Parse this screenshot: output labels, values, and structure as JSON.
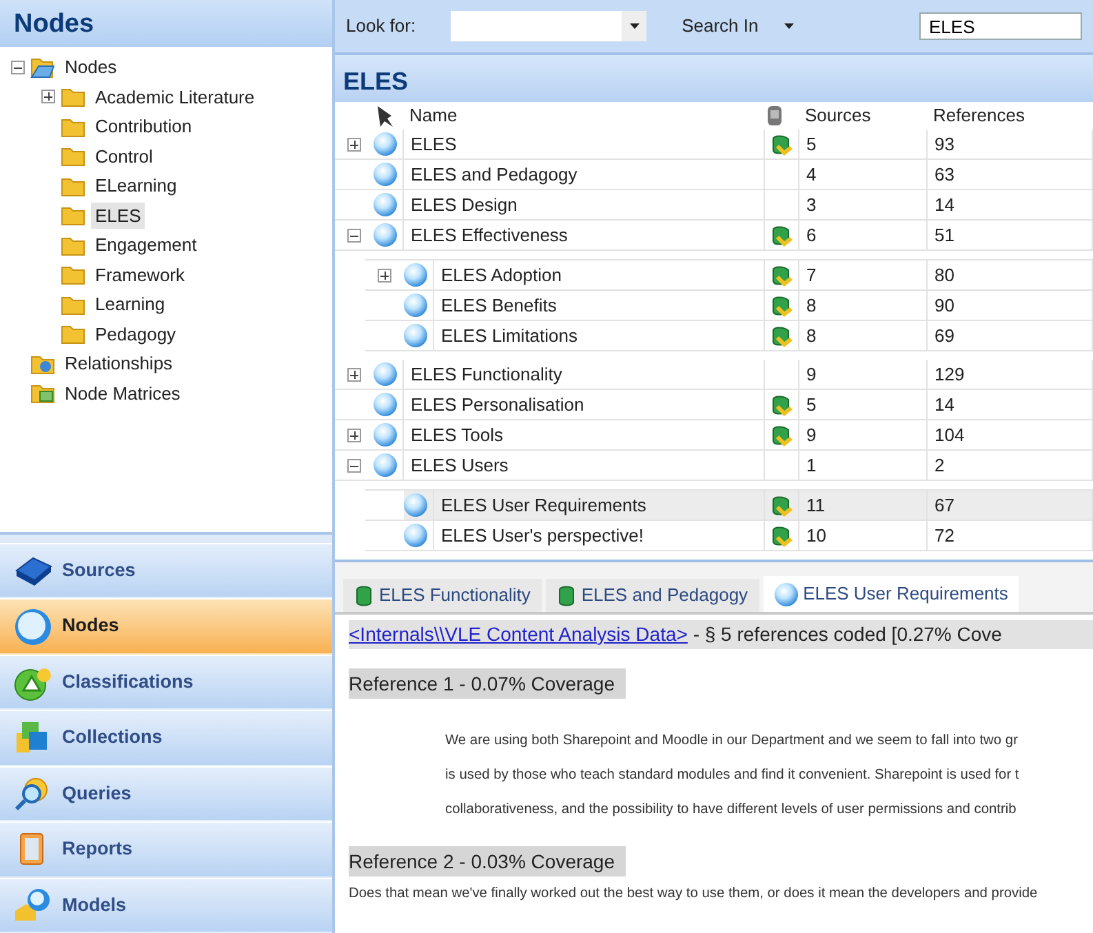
{
  "left_panel": {
    "title": "Nodes",
    "tree": [
      {
        "label": "Nodes",
        "kind": "open-folder",
        "expanded": true,
        "selected": false,
        "children": [
          {
            "label": "Academic Literature",
            "kind": "folder",
            "expanded": false,
            "selected": false
          },
          {
            "label": "Contribution",
            "kind": "folder",
            "selected": false
          },
          {
            "label": "Control",
            "kind": "folder",
            "selected": false
          },
          {
            "label": "ELearning",
            "kind": "folder",
            "selected": false
          },
          {
            "label": "ELES",
            "kind": "folder",
            "selected": true
          },
          {
            "label": "Engagement",
            "kind": "folder",
            "selected": false
          },
          {
            "label": "Framework",
            "kind": "folder",
            "selected": false
          },
          {
            "label": "Learning",
            "kind": "folder",
            "selected": false
          },
          {
            "label": "Pedagogy",
            "kind": "folder",
            "selected": false
          }
        ]
      },
      {
        "label": "Relationships",
        "kind": "relationships",
        "selected": false
      },
      {
        "label": "Node Matrices",
        "kind": "matrices",
        "selected": false
      }
    ],
    "nav": [
      {
        "label": "Sources",
        "kind": "sources",
        "selected": false
      },
      {
        "label": "Nodes",
        "kind": "nodes",
        "selected": true
      },
      {
        "label": "Classifications",
        "kind": "classifications",
        "selected": false
      },
      {
        "label": "Collections",
        "kind": "collections",
        "selected": false
      },
      {
        "label": "Queries",
        "kind": "queries",
        "selected": false
      },
      {
        "label": "Reports",
        "kind": "reports",
        "selected": false
      },
      {
        "label": "Models",
        "kind": "models",
        "selected": false
      }
    ]
  },
  "find_bar": {
    "look_for_label": "Look for:",
    "search_in_label": "Search In",
    "search_in_value": "ELES"
  },
  "list": {
    "title": "ELES",
    "columns": [
      "Name",
      "Sources",
      "References"
    ],
    "rows": [
      {
        "name": "ELES",
        "linked": true,
        "sources": "5",
        "references": "93",
        "expanded": false,
        "selected": false
      },
      {
        "name": "ELES and Pedagogy",
        "linked": false,
        "sources": "4",
        "references": "63",
        "selected": false
      },
      {
        "name": "ELES Design",
        "linked": false,
        "sources": "3",
        "references": "14",
        "selected": false
      },
      {
        "name": "ELES Effectiveness",
        "linked": true,
        "sources": "6",
        "references": "51",
        "expanded": true,
        "selected": false,
        "children": [
          {
            "name": "ELES Adoption",
            "linked": true,
            "sources": "7",
            "references": "80",
            "expanded": false,
            "selected": false
          },
          {
            "name": "ELES Benefits",
            "linked": true,
            "sources": "8",
            "references": "90",
            "selected": false
          },
          {
            "name": "ELES Limitations",
            "linked": true,
            "sources": "8",
            "references": "69",
            "selected": false
          }
        ]
      },
      {
        "name": "ELES Functionality",
        "linked": false,
        "sources": "9",
        "references": "129",
        "expanded": false,
        "selected": false
      },
      {
        "name": "ELES Personalisation",
        "linked": true,
        "sources": "5",
        "references": "14",
        "selected": false
      },
      {
        "name": "ELES Tools",
        "linked": true,
        "sources": "9",
        "references": "104",
        "expanded": false,
        "selected": false
      },
      {
        "name": "ELES Users",
        "linked": false,
        "sources": "1",
        "references": "2",
        "expanded": true,
        "selected": false,
        "children": [
          {
            "name": "ELES User Requirements",
            "linked": true,
            "sources": "11",
            "references": "67",
            "selected": true
          },
          {
            "name": "ELES User's perspective!",
            "linked": true,
            "sources": "10",
            "references": "72",
            "selected": false
          }
        ]
      }
    ]
  },
  "tabs": [
    {
      "label": "ELES Functionality",
      "kind": "source",
      "selected": false
    },
    {
      "label": "ELES and Pedagogy",
      "kind": "source",
      "selected": false
    },
    {
      "label": "ELES User Requirements",
      "kind": "node",
      "selected": true
    }
  ],
  "detail": {
    "source_link": "<Internals\\\\VLE Content Analysis Data>",
    "summary": " - § 5 references coded  [0.27% Cove",
    "references": [
      {
        "heading": "Reference 1 - 0.07% Coverage",
        "indented": true,
        "lines": [
          "We are using both Sharepoint and Moodle in our Department and we seem to fall into two gr",
          "is used by those who teach standard modules and find it convenient. Sharepoint is used for t",
          "collaborativeness, and the possibility to have different levels of user permissions and contrib"
        ]
      },
      {
        "heading": "Reference 2 - 0.03% Coverage",
        "indented": false,
        "lines": [
          "Does that mean we've finally worked out the best way to use them, or does it mean the developers and provide"
        ]
      }
    ]
  }
}
